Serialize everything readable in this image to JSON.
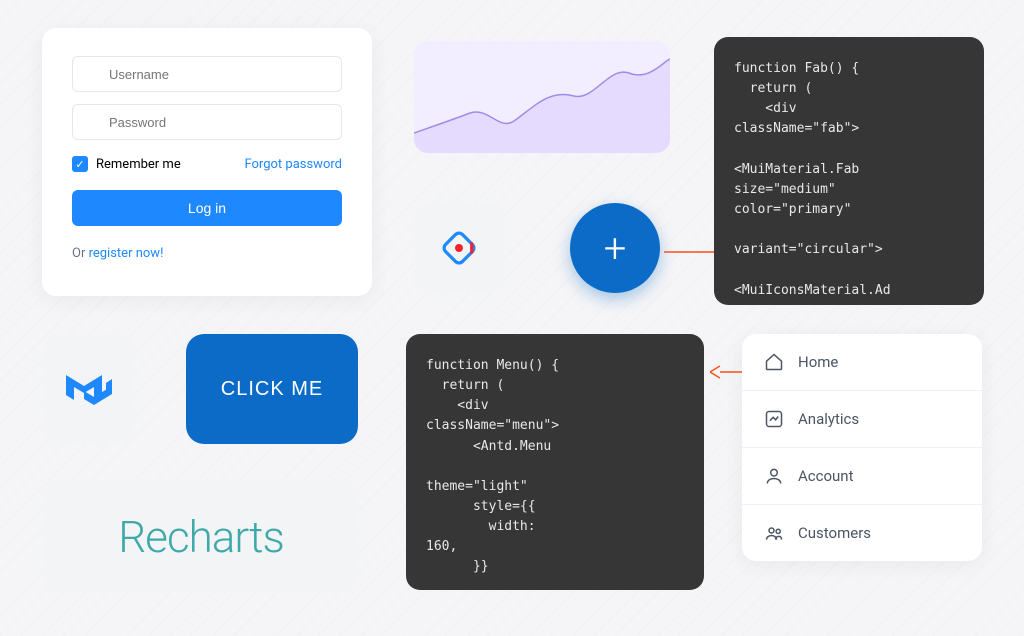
{
  "login": {
    "username_placeholder": "Username",
    "password_placeholder": "Password",
    "remember_label": "Remember me",
    "forgot_label": "Forgot password",
    "login_btn": "Log in",
    "or_prefix": "Or ",
    "register_link": "register now!"
  },
  "fab": {
    "plus": "+"
  },
  "code_fab": "function Fab() {\n  return (\n    <div\nclassName=\"fab\">\n\n<MuiMaterial.Fab\nsize=\"medium\"\ncolor=\"primary\"\n\nvariant=\"circular\">\n\n<MuiIconsMaterial.Ad",
  "code_menu": "function Menu() {\n  return (\n    <div\nclassName=\"menu\">\n      <Antd.Menu\n\ntheme=\"light\"\n      style={{\n        width:\n160,\n      }}",
  "buttons": {
    "clickme": "CLICK ME"
  },
  "recharts": {
    "label": "Recharts"
  },
  "menu": {
    "items": [
      {
        "label": "Home"
      },
      {
        "label": "Analytics"
      },
      {
        "label": "Account"
      },
      {
        "label": "Customers"
      }
    ]
  },
  "chart_data": {
    "type": "area",
    "x": [
      0,
      1,
      2,
      3,
      4,
      5,
      6,
      7,
      8,
      9
    ],
    "values": [
      20,
      28,
      35,
      22,
      30,
      60,
      55,
      80,
      72,
      85
    ],
    "ylim": [
      0,
      100
    ],
    "fill": "#e5dbff",
    "stroke": "#9f8ce8"
  }
}
